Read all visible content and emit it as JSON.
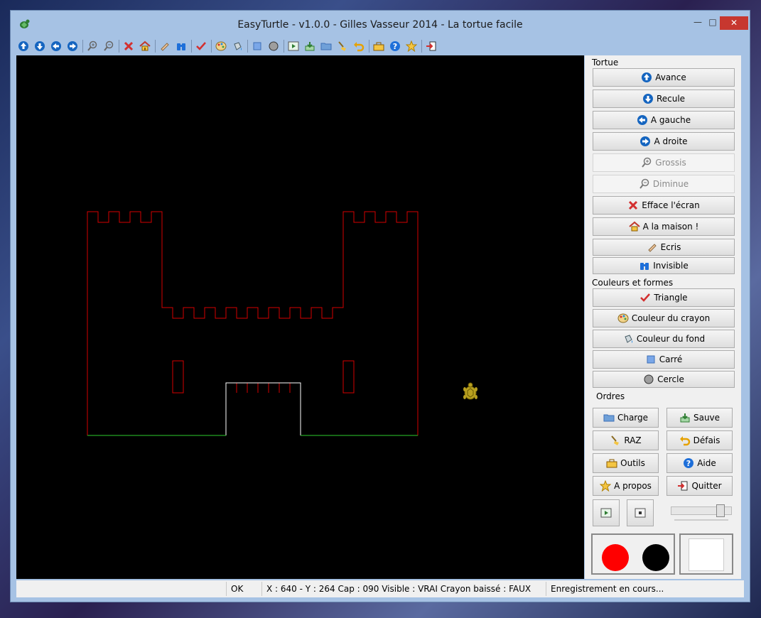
{
  "window": {
    "title": "EasyTurtle - v1.0.0 - Gilles Vasseur 2014 - La tortue facile",
    "minimize": "—",
    "maximize": "□",
    "close": "✕"
  },
  "toolbar": {
    "icons": [
      "up-arrow-icon",
      "down-arrow-icon",
      "left-arrow-icon",
      "right-arrow-icon",
      "zoom-in-icon",
      "zoom-out-icon",
      "clear-icon",
      "home-icon",
      "eraser-icon",
      "binoculars-icon",
      "check-icon",
      "palette-icon",
      "bucket-icon",
      "square-icon",
      "circle-icon",
      "play-icon",
      "save-icon",
      "folder-icon",
      "broom-icon",
      "undo-icon",
      "toolbox-icon",
      "help-icon",
      "star-icon",
      "exit-icon"
    ]
  },
  "panel": {
    "tortue_label": "Tortue",
    "avance": "Avance",
    "recule": "Recule",
    "gauche": "A gauche",
    "droite": "A droite",
    "grossis": "Grossis",
    "diminue": "Diminue",
    "efface": "Efface l'écran",
    "maison": "A la maison !",
    "ecris": "Ecris",
    "invisible": "Invisible",
    "couleurs_label": "Couleurs et formes",
    "triangle": "Triangle",
    "couleur_crayon": "Couleur du crayon",
    "couleur_fond": "Couleur du fond",
    "carre": "Carré",
    "cercle": "Cercle",
    "ordres_label": "Ordres",
    "charge": "Charge",
    "sauve": "Sauve",
    "raz": "RAZ",
    "defais": "Défais",
    "outils": "Outils",
    "aide": "Aide",
    "apropos": "A propos",
    "quitter": "Quitter",
    "speed_level": 0.85
  },
  "colors": {
    "pen": "#ff0000",
    "shape": "#000000",
    "background": "#ffffff",
    "drawing_red": "#d40000",
    "drawing_green": "#2ecc2e",
    "canvas": "#000000"
  },
  "status": {
    "state": "OK",
    "coords": "X : 640 - Y : 264 Cap : 090 Visible : VRAI Crayon baissé : FAUX",
    "recording": "Enregistrement en cours..."
  }
}
